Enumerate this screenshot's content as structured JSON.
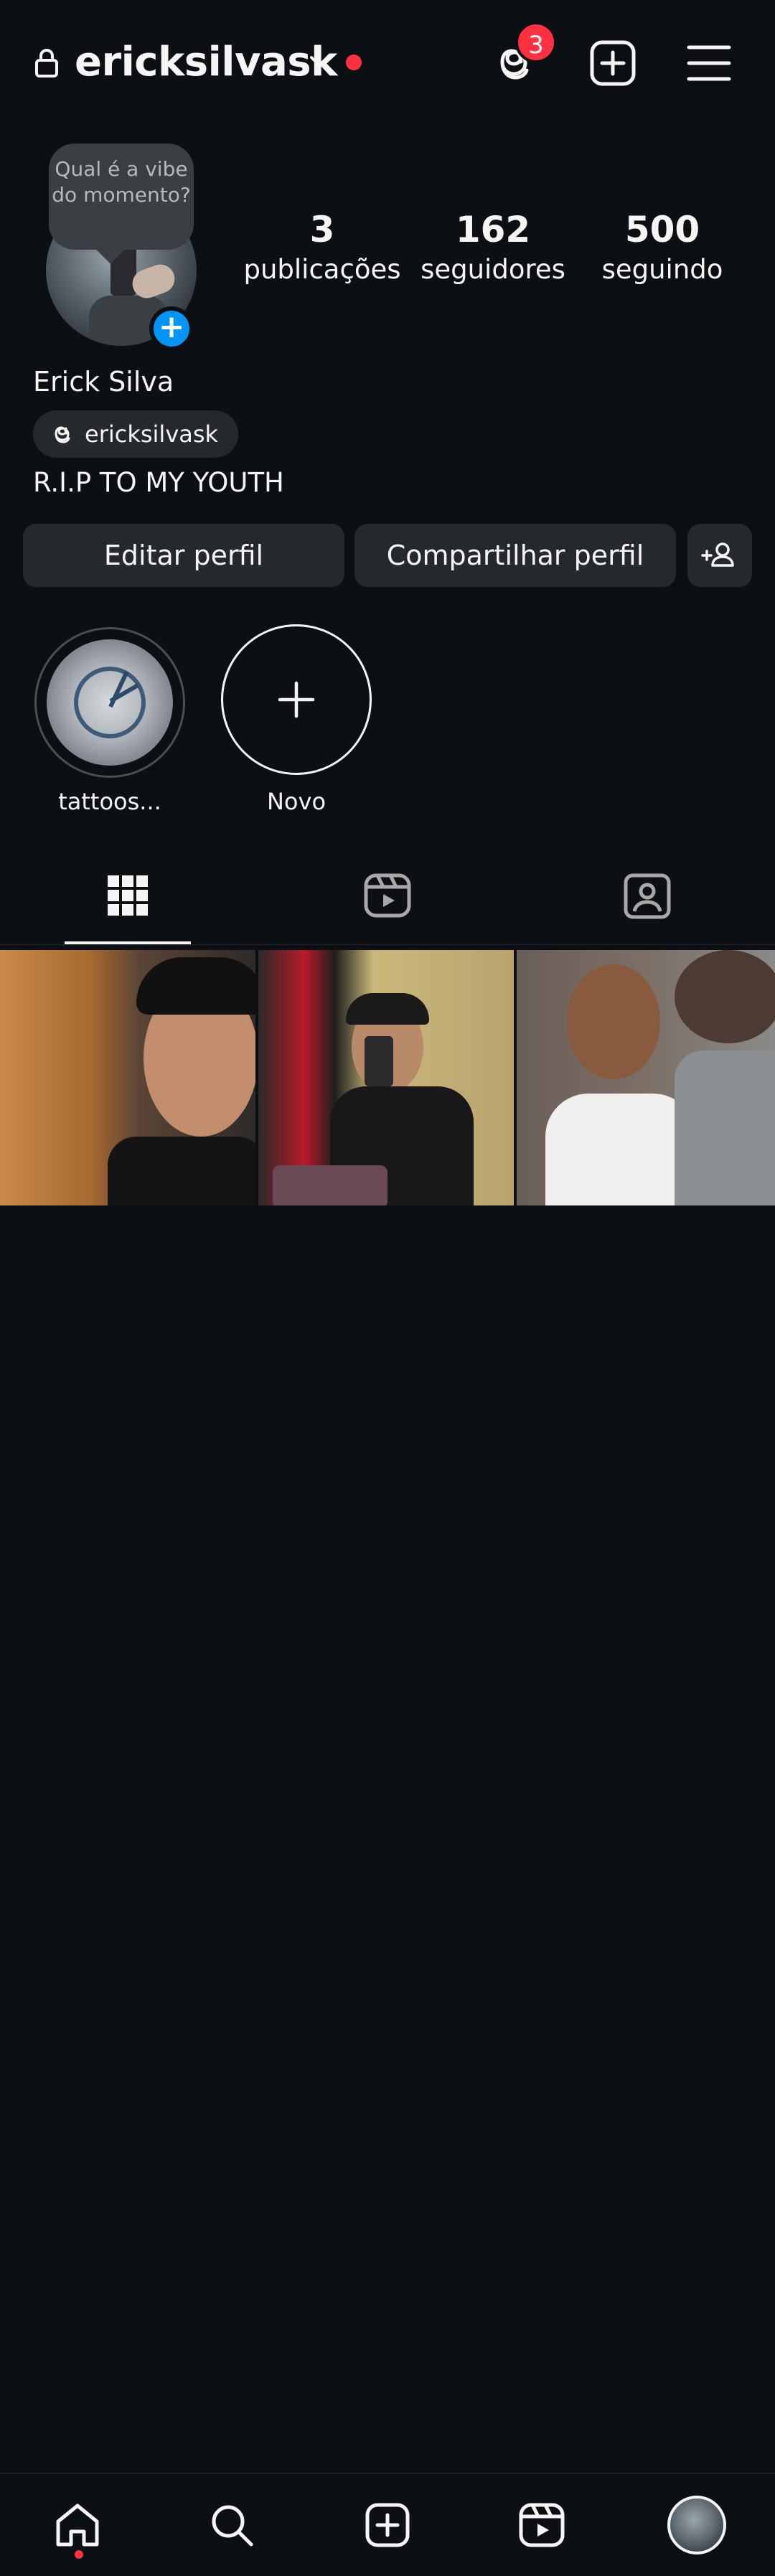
{
  "header": {
    "username": "ericksilvask",
    "threads_badge_count": "3",
    "icons": [
      "lock-icon",
      "chevron-down-icon",
      "threads-icon",
      "create-icon",
      "menu-icon"
    ]
  },
  "profile": {
    "note_bubble": "Qual é a vibe do momento?",
    "stats": [
      {
        "value": "3",
        "label": "publicações"
      },
      {
        "value": "162",
        "label": "seguidores"
      },
      {
        "value": "500",
        "label": "seguindo"
      }
    ],
    "full_name": "Erick Silva",
    "threads_handle": "ericksilvask",
    "bio": "R.I.P TO MY YOUTH"
  },
  "buttons": {
    "edit": "Editar perfil",
    "share": "Compartilhar perfil"
  },
  "highlights": [
    {
      "label": "tattoos..."
    },
    {
      "label": "Novo"
    }
  ],
  "tabs": [
    "grid-icon",
    "reels-icon",
    "tagged-icon"
  ],
  "posts_count": 3,
  "nav": [
    "home-icon",
    "search-icon",
    "create-icon",
    "reels-icon",
    "profile-avatar"
  ],
  "colors": {
    "background": "#0c1014",
    "button_bg": "#25292e",
    "accent_blue": "#0095f6",
    "notification_red": "#ff3040"
  }
}
